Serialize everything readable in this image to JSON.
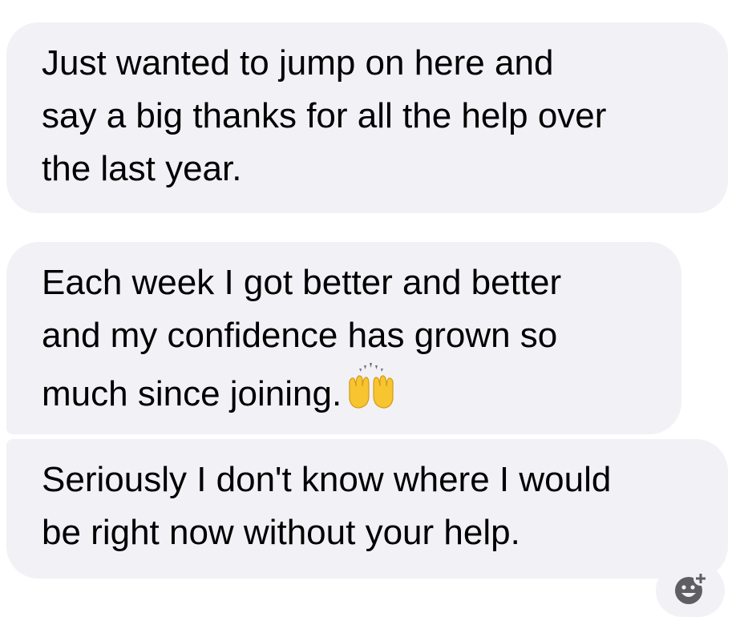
{
  "messages": [
    {
      "lines": [
        "Just wanted to jump on here and",
        "say a big thanks for all the help over",
        "the last year."
      ]
    },
    {
      "lines": [
        "Each week I got better and better",
        "and my confidence has grown so",
        "much since joining."
      ],
      "emoji": "raising-hands-emoji"
    },
    {
      "lines": [
        "Seriously I don't know where I would",
        "be right now without your help."
      ]
    }
  ],
  "reaction_button": {
    "icon": "add-reaction-icon"
  },
  "colors": {
    "bubble_background": "#f1f1f6",
    "text": "#000000",
    "icon": "#5f5f63",
    "emoji_hands": "#f7c530"
  }
}
